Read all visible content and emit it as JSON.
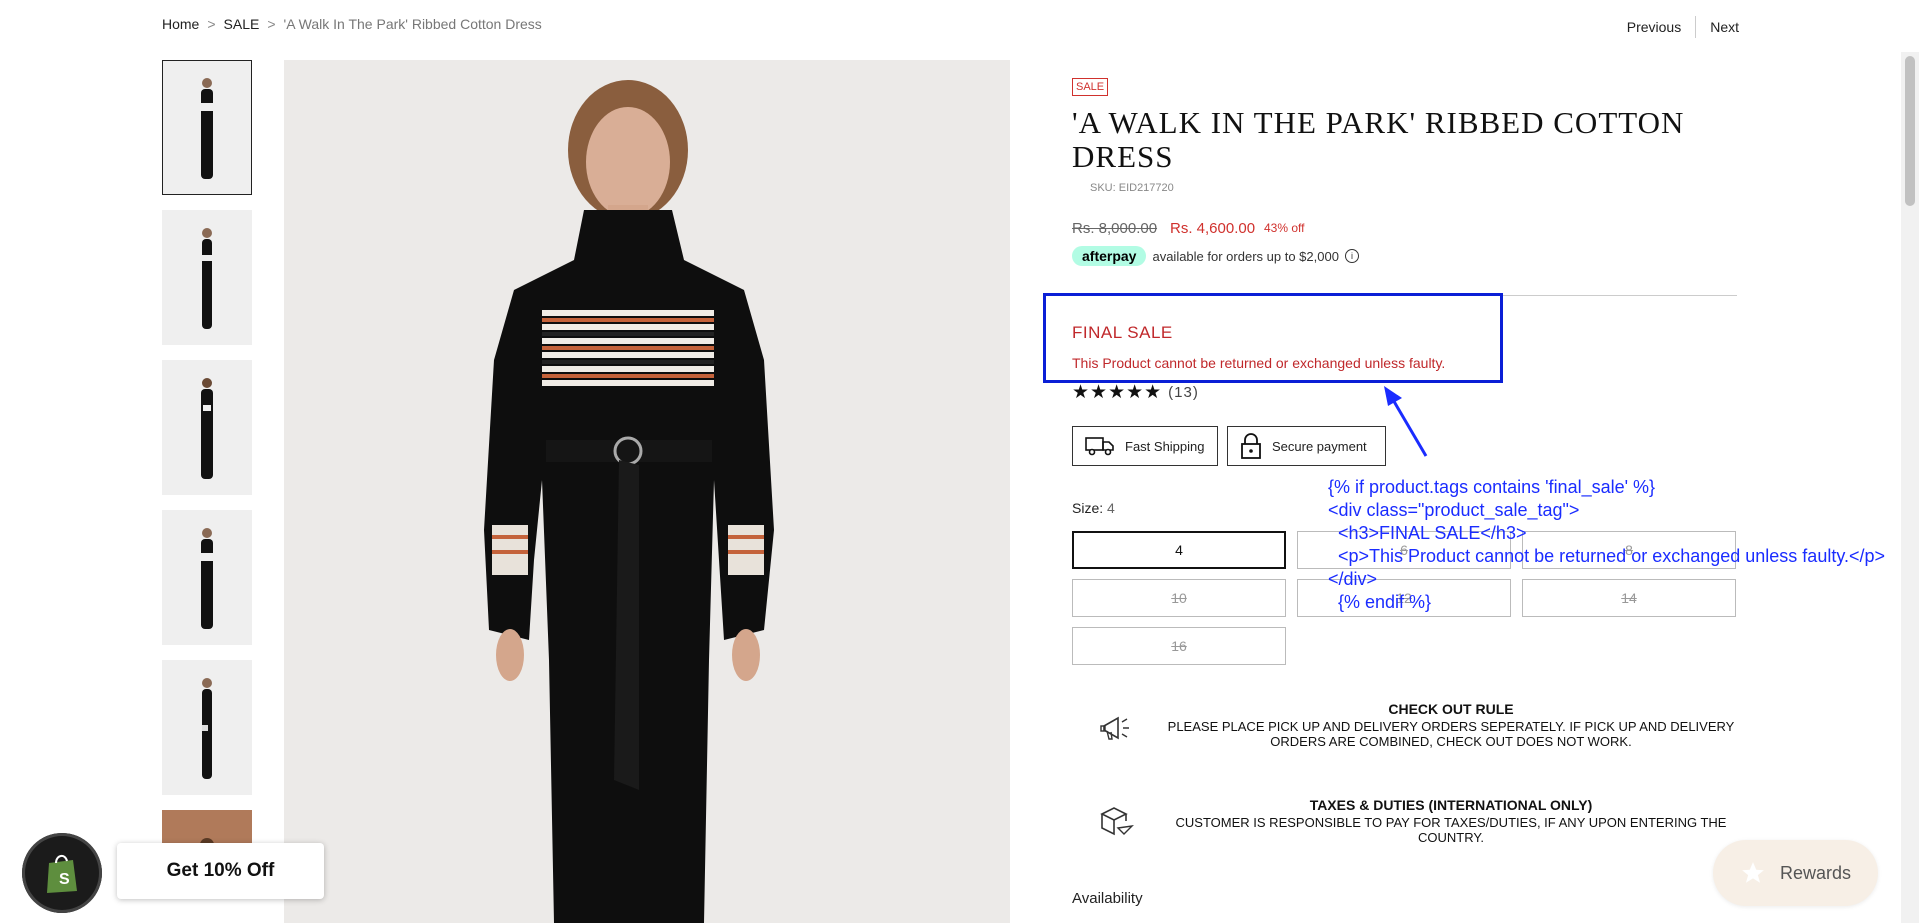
{
  "breadcrumb": {
    "home": "Home",
    "sale": "SALE",
    "current": "'A Walk In The Park' Ribbed Cotton Dress",
    "sep": ">"
  },
  "nav": {
    "previous": "Previous",
    "next": "Next"
  },
  "product": {
    "badge": "SALE",
    "title": "'A WALK IN THE PARK' RIBBED COTTON DRESS",
    "sku": "SKU: EID217720",
    "price_old": "Rs. 8,000.00",
    "price_new": "Rs. 4,600.00",
    "discount": "43% off",
    "afterpay_logo": "afterpay",
    "afterpay_text": "available for orders up to $2,000",
    "final_sale_title": "FINAL SALE",
    "final_sale_text": "This Product cannot be returned or exchanged unless faulty.",
    "rating_stars": "★★★★★",
    "rating_count": "(13)",
    "features": [
      {
        "label": "Fast Shipping",
        "icon": "truck-icon"
      },
      {
        "label": "Secure payment",
        "icon": "lock-icon"
      }
    ],
    "size_label": "Size:",
    "size_value": "4",
    "sizes": [
      {
        "label": "4",
        "selected": true,
        "available": true
      },
      {
        "label": "6",
        "selected": false,
        "available": false
      },
      {
        "label": "8",
        "selected": false,
        "available": false
      },
      {
        "label": "10",
        "selected": false,
        "available": false
      },
      {
        "label": "12",
        "selected": false,
        "available": false
      },
      {
        "label": "14",
        "selected": false,
        "available": false
      },
      {
        "label": "16",
        "selected": false,
        "available": false
      }
    ],
    "availability_label": "Availability"
  },
  "annotation_code": [
    "{% if product.tags contains 'final_sale' %}",
    "<div class=\"product_sale_tag\">",
    "  <h3>FINAL SALE</h3>",
    "  <p>This Product cannot be returned or exchanged unless faulty.</p>",
    "</div>",
    "  {% endif %}"
  ],
  "rules": [
    {
      "title": "CHECK OUT RULE",
      "text": "PLEASE PLACE PICK UP AND DELIVERY ORDERS SEPERATELY. IF PICK UP AND DELIVERY ORDERS ARE COMBINED, CHECK OUT DOES NOT WORK.",
      "icon": "megaphone-icon"
    },
    {
      "title": "TAXES & DUTIES (INTERNATIONAL ONLY)",
      "text": "CUSTOMER IS RESPONSIBLE TO PAY FOR TAXES/DUTIES, IF ANY UPON ENTERING THE COUNTRY.",
      "icon": "box-plane-icon"
    }
  ],
  "widgets": {
    "discount_popup": "Get 10% Off",
    "rewards": "Rewards"
  },
  "colors": {
    "sale_red": "#d0312d",
    "annotation_blue": "#0a1fd6",
    "afterpay_mint": "#b2fce4"
  }
}
